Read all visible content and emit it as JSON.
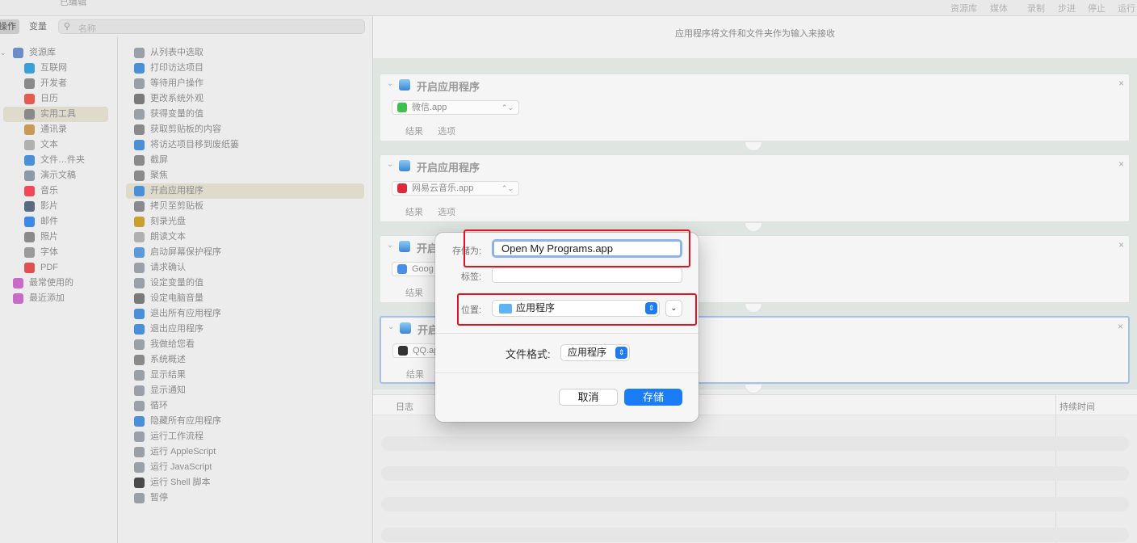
{
  "toolbar": {
    "window_title": "已编辑",
    "buttons": [
      "资源库",
      "媒体",
      "录制",
      "步进",
      "停止",
      "运行"
    ]
  },
  "left_tabs": {
    "actions": "操作",
    "variables": "变量"
  },
  "search": {
    "placeholder": "名称"
  },
  "library": [
    {
      "label": "资源库",
      "icon": "library-icon",
      "color": "#6b8cc7"
    },
    {
      "label": "互联网",
      "icon": "globe-icon",
      "color": "#3aa0d8"
    },
    {
      "label": "开发者",
      "icon": "tools-icon",
      "color": "#8a8a8a"
    },
    {
      "label": "日历",
      "icon": "calendar-icon",
      "color": "#e65b4f"
    },
    {
      "label": "实用工具",
      "icon": "tools-icon",
      "color": "#8a8a8a"
    },
    {
      "label": "通讯录",
      "icon": "contacts-icon",
      "color": "#c89a56"
    },
    {
      "label": "文本",
      "icon": "text-icon",
      "color": "#b0b0b0"
    },
    {
      "label": "文件…件夹",
      "icon": "finder-icon",
      "color": "#4a90d9"
    },
    {
      "label": "演示文稿",
      "icon": "presentation-icon",
      "color": "#8a9aa8"
    },
    {
      "label": "音乐",
      "icon": "music-icon",
      "color": "#f04a5a"
    },
    {
      "label": "影片",
      "icon": "movie-icon",
      "color": "#5a6a80"
    },
    {
      "label": "邮件",
      "icon": "mail-icon",
      "color": "#3a8ae6"
    },
    {
      "label": "照片",
      "icon": "photo-icon",
      "color": "#8a8a8a"
    },
    {
      "label": "字体",
      "icon": "font-icon",
      "color": "#9a9a9a"
    },
    {
      "label": "PDF",
      "icon": "pdf-icon",
      "color": "#e05050"
    },
    {
      "label": "最常使用的",
      "icon": "smart-folder-icon",
      "color": "#c86ac8"
    },
    {
      "label": "最近添加",
      "icon": "smart-folder-icon",
      "color": "#c86ac8"
    }
  ],
  "library_selected": 4,
  "actions": [
    {
      "label": "从列表中选取",
      "icon": "automator-icon",
      "color": "#9aa0a8"
    },
    {
      "label": "打印访达项目",
      "icon": "finder-icon",
      "color": "#4a90d9"
    },
    {
      "label": "等待用户操作",
      "icon": "automator-icon",
      "color": "#9aa0a8"
    },
    {
      "label": "更改系统外观",
      "icon": "gear-icon",
      "color": "#7a7a7a"
    },
    {
      "label": "获得变量的值",
      "icon": "automator-icon",
      "color": "#9aa0a8"
    },
    {
      "label": "获取剪贴板的内容",
      "icon": "tools-icon",
      "color": "#8a8a8a"
    },
    {
      "label": "将访达项目移到废纸篓",
      "icon": "finder-icon",
      "color": "#4a90d9"
    },
    {
      "label": "截屏",
      "icon": "tools-icon",
      "color": "#8a8a8a"
    },
    {
      "label": "聚焦",
      "icon": "search-icon",
      "color": "#8a8a8a"
    },
    {
      "label": "开启应用程序",
      "icon": "finder-icon",
      "color": "#4a90d9"
    },
    {
      "label": "拷贝至剪贴板",
      "icon": "tools-icon",
      "color": "#8a8a8a"
    },
    {
      "label": "刻录光盘",
      "icon": "burn-icon",
      "color": "#c8a030"
    },
    {
      "label": "朗读文本",
      "icon": "text-icon",
      "color": "#b0b0b0"
    },
    {
      "label": "启动屏幕保护程序",
      "icon": "screensaver-icon",
      "color": "#5a9ad8"
    },
    {
      "label": "请求确认",
      "icon": "automator-icon",
      "color": "#9aa0a8"
    },
    {
      "label": "设定变量的值",
      "icon": "automator-icon",
      "color": "#9aa0a8"
    },
    {
      "label": "设定电脑音量",
      "icon": "gear-icon",
      "color": "#7a7a7a"
    },
    {
      "label": "退出所有应用程序",
      "icon": "finder-icon",
      "color": "#4a90d9"
    },
    {
      "label": "退出应用程序",
      "icon": "finder-icon",
      "color": "#4a90d9"
    },
    {
      "label": "我做给您看",
      "icon": "automator-icon",
      "color": "#9aa0a8"
    },
    {
      "label": "系统概述",
      "icon": "tools-icon",
      "color": "#8a8a8a"
    },
    {
      "label": "显示结果",
      "icon": "automator-icon",
      "color": "#9aa0a8"
    },
    {
      "label": "显示通知",
      "icon": "automator-icon",
      "color": "#9aa0a8"
    },
    {
      "label": "循环",
      "icon": "automator-icon",
      "color": "#9aa0a8"
    },
    {
      "label": "隐藏所有应用程序",
      "icon": "finder-icon",
      "color": "#4a90d9"
    },
    {
      "label": "运行工作流程",
      "icon": "automator-icon",
      "color": "#9aa0a8"
    },
    {
      "label": "运行 AppleScript",
      "icon": "automator-icon",
      "color": "#9aa0a8"
    },
    {
      "label": "运行 JavaScript",
      "icon": "automator-icon",
      "color": "#9aa0a8"
    },
    {
      "label": "运行 Shell 脚本",
      "icon": "terminal-icon",
      "color": "#4a4a4a"
    },
    {
      "label": "暂停",
      "icon": "automator-icon",
      "color": "#9aa0a8"
    }
  ],
  "actions_selected": 9,
  "workflow": {
    "header": "应用程序将文件和文件夹作为输入来接收",
    "cards": [
      {
        "title": "开启应用程序",
        "app": "微信.app",
        "app_color": "#3cc14a",
        "tabs": [
          "结果",
          "选项"
        ]
      },
      {
        "title": "开启应用程序",
        "app": "网易云音乐.app",
        "app_color": "#e0283a",
        "tabs": [
          "结果",
          "选项"
        ]
      },
      {
        "title": "开启",
        "app": "Goog",
        "app_color": "#4a8ee8",
        "tabs": [
          "结果"
        ]
      },
      {
        "title": "开启",
        "app": "QQ.ap",
        "app_color": "#333333",
        "tabs": [
          "结果"
        ]
      }
    ],
    "close_glyph": "×"
  },
  "log": {
    "col_log": "日志",
    "col_duration": "持续时间"
  },
  "dialog": {
    "save_as_label": "存储为:",
    "save_as_value": "Open My Programs.app",
    "tags_label": "标签:",
    "location_label": "位置:",
    "location_value": "应用程序",
    "format_label": "文件格式:",
    "format_value": "应用程序",
    "cancel": "取消",
    "save": "存储"
  },
  "colors": {
    "accent": "#1a7df5",
    "highlight": "#e0141e"
  }
}
